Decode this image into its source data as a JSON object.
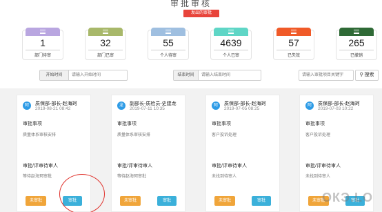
{
  "header": {
    "title": "审批审核",
    "badge": "发出的审批"
  },
  "stats": [
    {
      "value": "1",
      "label": "部门待审",
      "color": "#b9a6e0"
    },
    {
      "value": "32",
      "label": "部门已审",
      "color": "#a8b86a"
    },
    {
      "value": "55",
      "label": "个人待审",
      "color": "#9fbfe0"
    },
    {
      "value": "4639",
      "label": "个人已审",
      "color": "#5fd6c6"
    },
    {
      "value": "57",
      "label": "已失效",
      "color": "#f05a28"
    },
    {
      "value": "265",
      "label": "已撤销",
      "color": "#2f6a36"
    }
  ],
  "filters": {
    "start_label": "开始时间",
    "start_placeholder": "请输入开始时间",
    "end_label": "结束时间",
    "end_placeholder": "请输入结束时间",
    "search_placeholder": "请输入审批项目关键字",
    "search_button": "搜索"
  },
  "cards": [
    {
      "avatar": "阿",
      "dept": "质保部-部长-赵海珂",
      "date": "2019-08-21 08:42",
      "item_title": "审批事项",
      "item_value": "质量体系审核安排",
      "approver_title": "审批/评审待审人",
      "approver_value": "等待赵海珂审批",
      "btn_pending": "未审批",
      "btn_approve": "审批"
    },
    {
      "avatar": "龙",
      "dept": "副部长-质检员-史建龙",
      "date": "2019-07-11 10:35",
      "item_title": "审批事项",
      "item_value": "质量体系审核安排",
      "approver_title": "审批/评审待审人",
      "approver_value": "等待赵海珂审批",
      "btn_pending": "未审批",
      "btn_approve": "审批"
    },
    {
      "avatar": "阿",
      "dept": "质保部-部长-赵海珂",
      "date": "2019-07-05 08:25",
      "item_title": "审批事项",
      "item_value": "客户投诉处理",
      "approver_title": "审批/评审待审人",
      "approver_value": "未找到待审人",
      "btn_pending": "未审批",
      "btn_approve": "审批"
    },
    {
      "avatar": "阿",
      "dept": "质保部-部长-赵海珂",
      "date": "2019-07-03 10:22",
      "item_title": "审批事项",
      "item_value": "客户投诉处理",
      "approver_title": "审批/评审待审人",
      "approver_value": "未找到待审人",
      "btn_pending": "未审批",
      "btn_approve": "审批"
    }
  ],
  "watermark": "ОКЭ.LO"
}
